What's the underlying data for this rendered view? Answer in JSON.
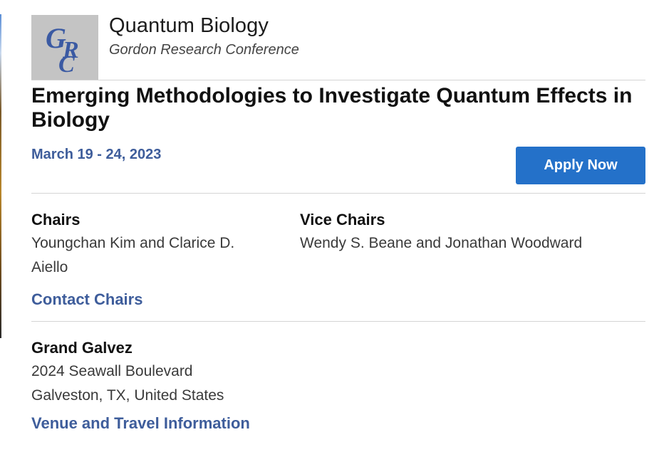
{
  "header": {
    "logo_text": "GRC",
    "conference_title": "Quantum Biology",
    "conference_subtitle": "Gordon Research Conference"
  },
  "main": {
    "title": "Emerging Methodologies to Investigate Quantum Effects in Biology",
    "dates": "March 19 - 24, 2023",
    "apply_label": "Apply Now"
  },
  "chairs": {
    "heading": "Chairs",
    "names_line1": "Youngchan Kim and Clarice D.",
    "names_line2": "Aiello",
    "contact_label": "Contact Chairs"
  },
  "vice_chairs": {
    "heading": "Vice Chairs",
    "names": "Wendy S. Beane and Jonathan Woodward"
  },
  "venue": {
    "name": "Grand Galvez",
    "address_line1": "2024 Seawall Boulevard",
    "address_line2": "Galveston, TX, United States",
    "info_label": "Venue and Travel Information"
  }
}
